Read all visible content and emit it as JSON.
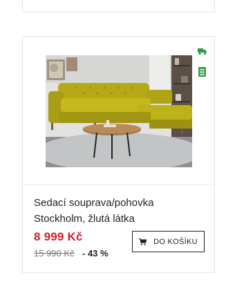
{
  "product": {
    "name": "Sedací souprava/pohovka Stockholm, žlutá látka",
    "price": "8 999 Kč",
    "old_price": "15 990 Kč",
    "discount": "- 43 %",
    "cart_button_label": "DO KOŠÍKU",
    "photo_alt": "Sedací souprava Stockholm",
    "flags": [
      {
        "icon": "truck-icon",
        "color": "#2e9d3f"
      },
      {
        "icon": "warehouse-icon",
        "color": "#2e9d3f"
      }
    ]
  },
  "colors": {
    "price": "#d41c2a",
    "accent_green": "#2e9d3f",
    "border": "#e4e4e4"
  }
}
